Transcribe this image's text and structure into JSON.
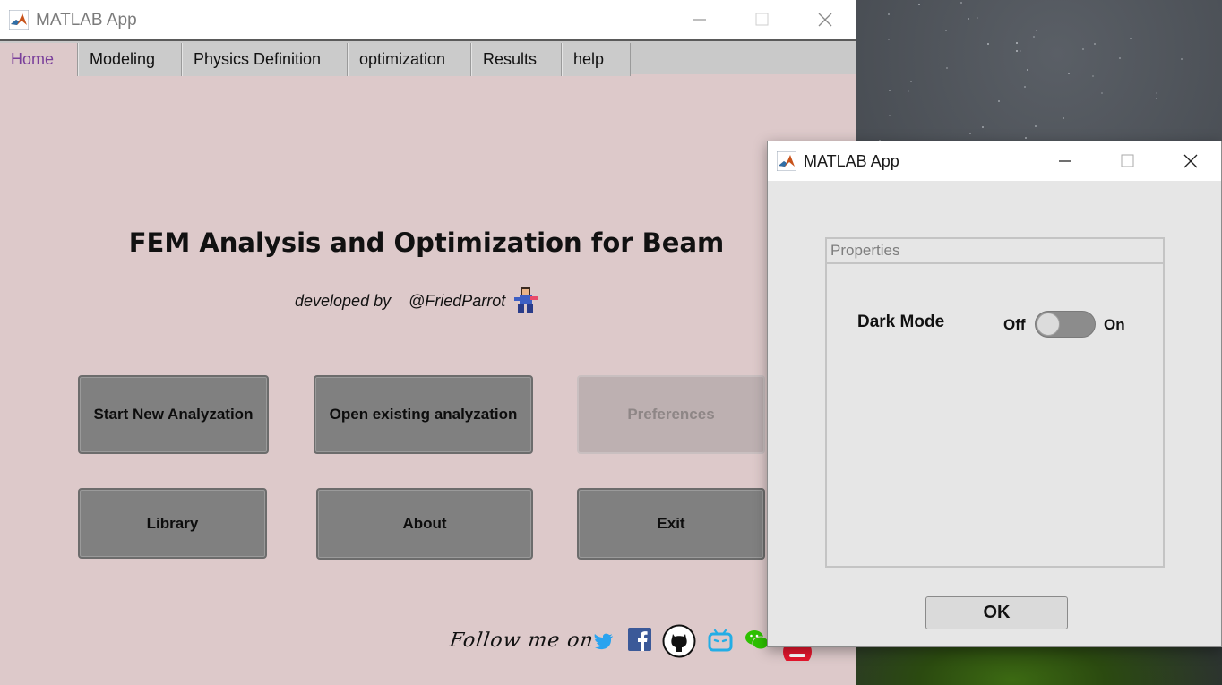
{
  "main_window": {
    "title": "MATLAB App",
    "tabs": [
      {
        "label": "Home",
        "active": true
      },
      {
        "label": "Modeling"
      },
      {
        "label": "Physics Definition"
      },
      {
        "label": "optimization"
      },
      {
        "label": "Results"
      },
      {
        "label": "help"
      }
    ],
    "heading": "FEM Analysis and Optimization for Beam",
    "developed_by_label": "developed by",
    "developer_handle": "@FriedParrot",
    "buttons": {
      "start_new": "Start New Analyzation",
      "open_existing": "Open existing analyzation",
      "preferences": "Preferences",
      "library": "Library",
      "about": "About",
      "exit": "Exit"
    },
    "follow_text": "Follow me on",
    "social_icons": [
      "twitter-icon",
      "facebook-icon",
      "github-icon",
      "bilibili-icon",
      "wechat-icon",
      "weibo-icon"
    ]
  },
  "dialog": {
    "title": "MATLAB App",
    "panel_title": "Properties",
    "dark_mode_label": "Dark Mode",
    "toggle_off_label": "Off",
    "toggle_on_label": "On",
    "dark_mode_value": "Off",
    "ok_label": "OK"
  },
  "colors": {
    "main_background": "#ddc9ca",
    "button_gray": "#808080",
    "active_tab_text": "#7a3f9b",
    "dialog_background": "#e6e6e6"
  }
}
